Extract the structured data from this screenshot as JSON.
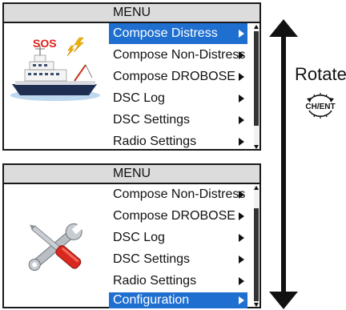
{
  "panel1": {
    "title": "MENU",
    "items": [
      {
        "label": "Compose Distress",
        "selected": true
      },
      {
        "label": "Compose Non-Distress",
        "selected": false
      },
      {
        "label": "Compose DROBOSE",
        "selected": false
      },
      {
        "label": "DSC Log",
        "selected": false
      },
      {
        "label": "DSC Settings",
        "selected": false
      },
      {
        "label": "Radio Settings",
        "selected": false
      }
    ],
    "illustration": {
      "icon": "ship-icon",
      "sos_text": "SOS"
    }
  },
  "panel2": {
    "title": "MENU",
    "items": [
      {
        "label": "Compose Non-Distress",
        "selected": false
      },
      {
        "label": "Compose DROBOSE",
        "selected": false
      },
      {
        "label": "DSC Log",
        "selected": false
      },
      {
        "label": "DSC Settings",
        "selected": false
      },
      {
        "label": "Radio Settings",
        "selected": false
      },
      {
        "label": "Configuration",
        "selected": true
      }
    ],
    "illustration": {
      "icon": "tools-icon"
    }
  },
  "side": {
    "rotate_label": "Rotate",
    "dial_label": "CH/ENT",
    "arrow_icon": "up-down-arrow-icon"
  },
  "colors": {
    "selection": "#1f6fd0",
    "header": "#dcdcdc",
    "border": "#1a1a1a",
    "sos": "#e0201a"
  }
}
